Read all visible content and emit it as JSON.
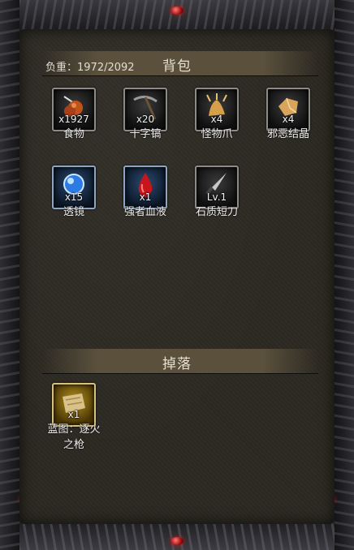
{
  "inventory": {
    "title": "背包",
    "weight_label": "负重：1972/2092",
    "items": [
      {
        "name": "食物",
        "count": "x1927",
        "icon": "food-icon"
      },
      {
        "name": "十字镐",
        "count": "x20",
        "icon": "pickaxe-icon"
      },
      {
        "name": "怪物爪",
        "count": "x4",
        "icon": "monster-claw-icon"
      },
      {
        "name": "邪恶结晶",
        "count": "x4",
        "icon": "evil-crystal-icon"
      },
      {
        "name": "透镜",
        "count": "x15",
        "icon": "lens-icon"
      },
      {
        "name": "强者血液",
        "count": "x1",
        "icon": "blood-drop-icon"
      },
      {
        "name": "石质短刀",
        "count": "Lv.1",
        "icon": "stone-dagger-icon"
      }
    ]
  },
  "drops": {
    "title": "掉落",
    "items": [
      {
        "name": "蓝图：逐火之枪",
        "count": "x1",
        "icon": "blueprint-scroll-icon"
      }
    ]
  },
  "colors": {
    "panel": "#2c2922",
    "section_bar": "#5a503c",
    "gem": "#c01818"
  }
}
